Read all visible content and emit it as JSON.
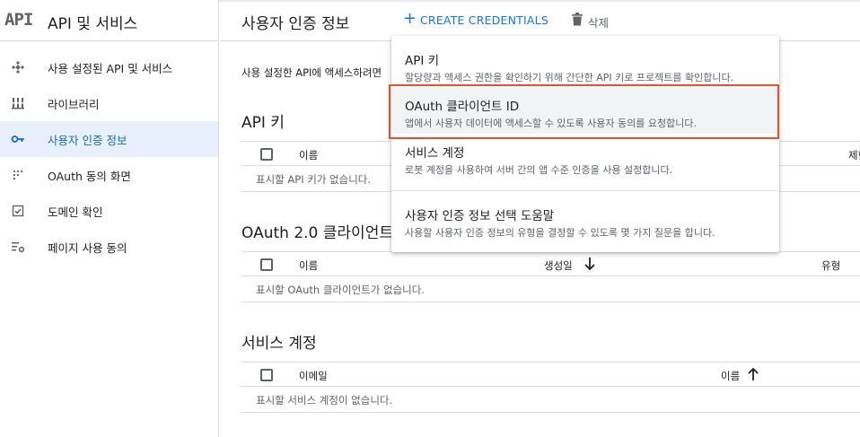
{
  "app": {
    "logo": "API",
    "title": "API 및 서비스"
  },
  "sidebar": {
    "items": [
      {
        "label": "사용 설정된 API 및 서비스",
        "icon": "api-diamond-icon"
      },
      {
        "label": "라이브러리",
        "icon": "library-icon"
      },
      {
        "label": "사용자 인증 정보",
        "icon": "key-icon",
        "active": true
      },
      {
        "label": "OAuth 동의 화면",
        "icon": "consent-dots-icon"
      },
      {
        "label": "도메인 확인",
        "icon": "domain-check-icon"
      },
      {
        "label": "페이지 사용 동의",
        "icon": "settings-list-icon"
      }
    ]
  },
  "header": {
    "title": "사용자 인증 정보",
    "create_label": "CREATE CREDENTIALS",
    "delete_label": "삭제"
  },
  "main": {
    "intro": "사용 설정한 API에 액세스하려면",
    "api_keys": {
      "title": "API 키",
      "col_name": "이름",
      "col_restriction": "제한",
      "empty": "표시할 API 키가 없습니다."
    },
    "oauth": {
      "title": "OAuth 2.0 클라이언트",
      "col_name": "이름",
      "col_created": "생성일",
      "col_type": "유형",
      "empty": "표시할 OAuth 클라이언트가 없습니다."
    },
    "service_accounts": {
      "title": "서비스 계정",
      "col_email": "이메일",
      "col_name": "이름",
      "empty": "표시할 서비스 계정이 없습니다."
    }
  },
  "menu": {
    "items": [
      {
        "title": "API 키",
        "desc": "할당량과 액세스 권한을 확인하기 위해 간단한 API 키로 프로젝트를 확인합니다."
      },
      {
        "title": "OAuth 클라이언트 ID",
        "desc": "앱에서 사용자 데이터에 액세스할 수 있도록 사용자 동의를 요청합니다."
      },
      {
        "title": "서비스 계정",
        "desc": "로봇 계정을 사용하여 서버 간의 앱 수준 인증을 사용 설정합니다."
      },
      {
        "title": "사용자 인증 정보 선택 도움말",
        "desc": "사용할 사용자 인증 정보의 유형을 결정할 수 있도록 몇 가지 질문을 합니다."
      }
    ]
  },
  "colors": {
    "accent": "#1a73e8",
    "active_bg": "#e8f0fe",
    "highlight_box": "#e8502b"
  }
}
